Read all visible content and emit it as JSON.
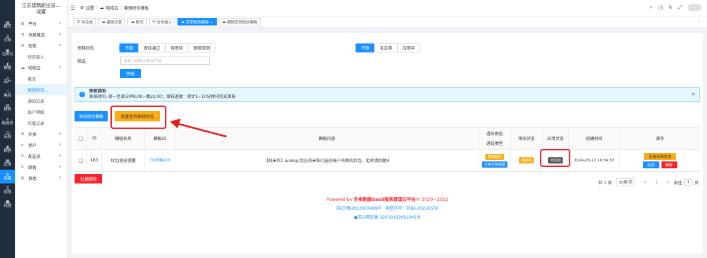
{
  "rail": [
    {
      "label": "概况",
      "icon": "grid-icon"
    },
    {
      "label": "订单",
      "icon": "list-icon"
    },
    {
      "label": "当面付",
      "icon": "qrcode-icon"
    },
    {
      "label": "数据",
      "icon": "chart-icon"
    },
    {
      "label": "商户",
      "icon": "store-icon"
    },
    {
      "label": "售后",
      "icon": "headset-icon"
    },
    {
      "label": "财务",
      "icon": "wallet-icon"
    },
    {
      "label": "配送员",
      "icon": "rider-icon"
    },
    {
      "label": "店员",
      "icon": "user-icon"
    },
    {
      "label": "顾客",
      "icon": "customer-icon"
    },
    {
      "label": "应用",
      "icon": "apps-icon"
    },
    {
      "label": "设置",
      "icon": "gear-icon"
    },
    {
      "label": "权限",
      "icon": "lock-icon"
    },
    {
      "label": "代理",
      "icon": "agent-icon"
    }
  ],
  "side": {
    "title_line1": "江苏建筑职业技...",
    "title_line2": "设置",
    "items": [
      {
        "label": "平台",
        "icon": "platform-icon",
        "chev": "∨"
      },
      {
        "label": "消息推送",
        "icon": "bell-icon",
        "chev": "∨"
      },
      {
        "label": "短信",
        "icon": "mail-icon",
        "chev": "∧"
      }
    ],
    "sms_sub": "短信接入",
    "cloud": {
      "label": "啦啦云",
      "chev": "∧"
    },
    "cloud_subs": [
      "概况",
      "营销短信...",
      "通知记录",
      "账户明细",
      "充值记录"
    ],
    "items2": [
      {
        "label": "外卖",
        "chev": "∨"
      },
      {
        "label": "商户",
        "chev": "∨"
      },
      {
        "label": "配送员",
        "chev": "∨"
      },
      {
        "label": "顾客",
        "chev": "∨"
      },
      {
        "label": "其他",
        "chev": "∨"
      }
    ]
  },
  "header": {
    "crumbs": [
      "设置",
      "啦啦云",
      "营销短信模板"
    ]
  },
  "tabs": [
    "未完成",
    "基础设置",
    "概况",
    "短信接入",
    "营销短信模板",
    "编辑营销短信模板"
  ],
  "filter": {
    "status_label": "审核状态",
    "status_options": [
      "不限",
      "审核通过",
      "待审核",
      "审核驳回"
    ],
    "apply_options": [
      "不限",
      "未应用",
      "应用中"
    ],
    "search_label": "筛选",
    "search_placeholder": "请输入模板名称或内容",
    "search_button": "筛选"
  },
  "notice": {
    "title": "审核说明",
    "text": "审核时间: 周一至周日早8:00~晚22:00；审核速度：预计1~10分钟内完成审核"
  },
  "actions": {
    "add": "添加短信模板",
    "batch_query": "批量查询审核状态",
    "batch_delete": "批量删除"
  },
  "table": {
    "headers": [
      "ID",
      "模板名称",
      "模板ID",
      "模板内容",
      "通知角色",
      "通知类型",
      "审核状态",
      "应用状态",
      "创建时间",
      "操作"
    ],
    "row": {
      "id": "183",
      "name": "红包发放提醒",
      "template_id": "70088420",
      "content": "【校米粒】&nbsp;您在校米粒闪送的账户有新的红包，拒收请回复R",
      "role_tag": "营销短信",
      "type_tag": "红包发放提醒",
      "audit": "待审核",
      "apply": "未应用",
      "created": "2024-03-12 19:34:37",
      "op_query": "查询审核状态",
      "op_apply": "应用",
      "op_delete": "删除"
    }
  },
  "pager": {
    "total": "共 1 条",
    "size": "20条/页",
    "prev": "<",
    "page": "1",
    "next": ">",
    "goto": "前往",
    "goto_page": "1",
    "unit": "页"
  },
  "footer": {
    "line1_pre": "Powered by ",
    "line1_brand": "外卖跑腿SaaS服务管理云平台",
    "line1_post": "© 2020~2022",
    "icp": "苏ICP备2022007489号",
    "telecom": "电信许可：苏B2-20220556",
    "police": "苏公网安备 32030302001041号"
  }
}
